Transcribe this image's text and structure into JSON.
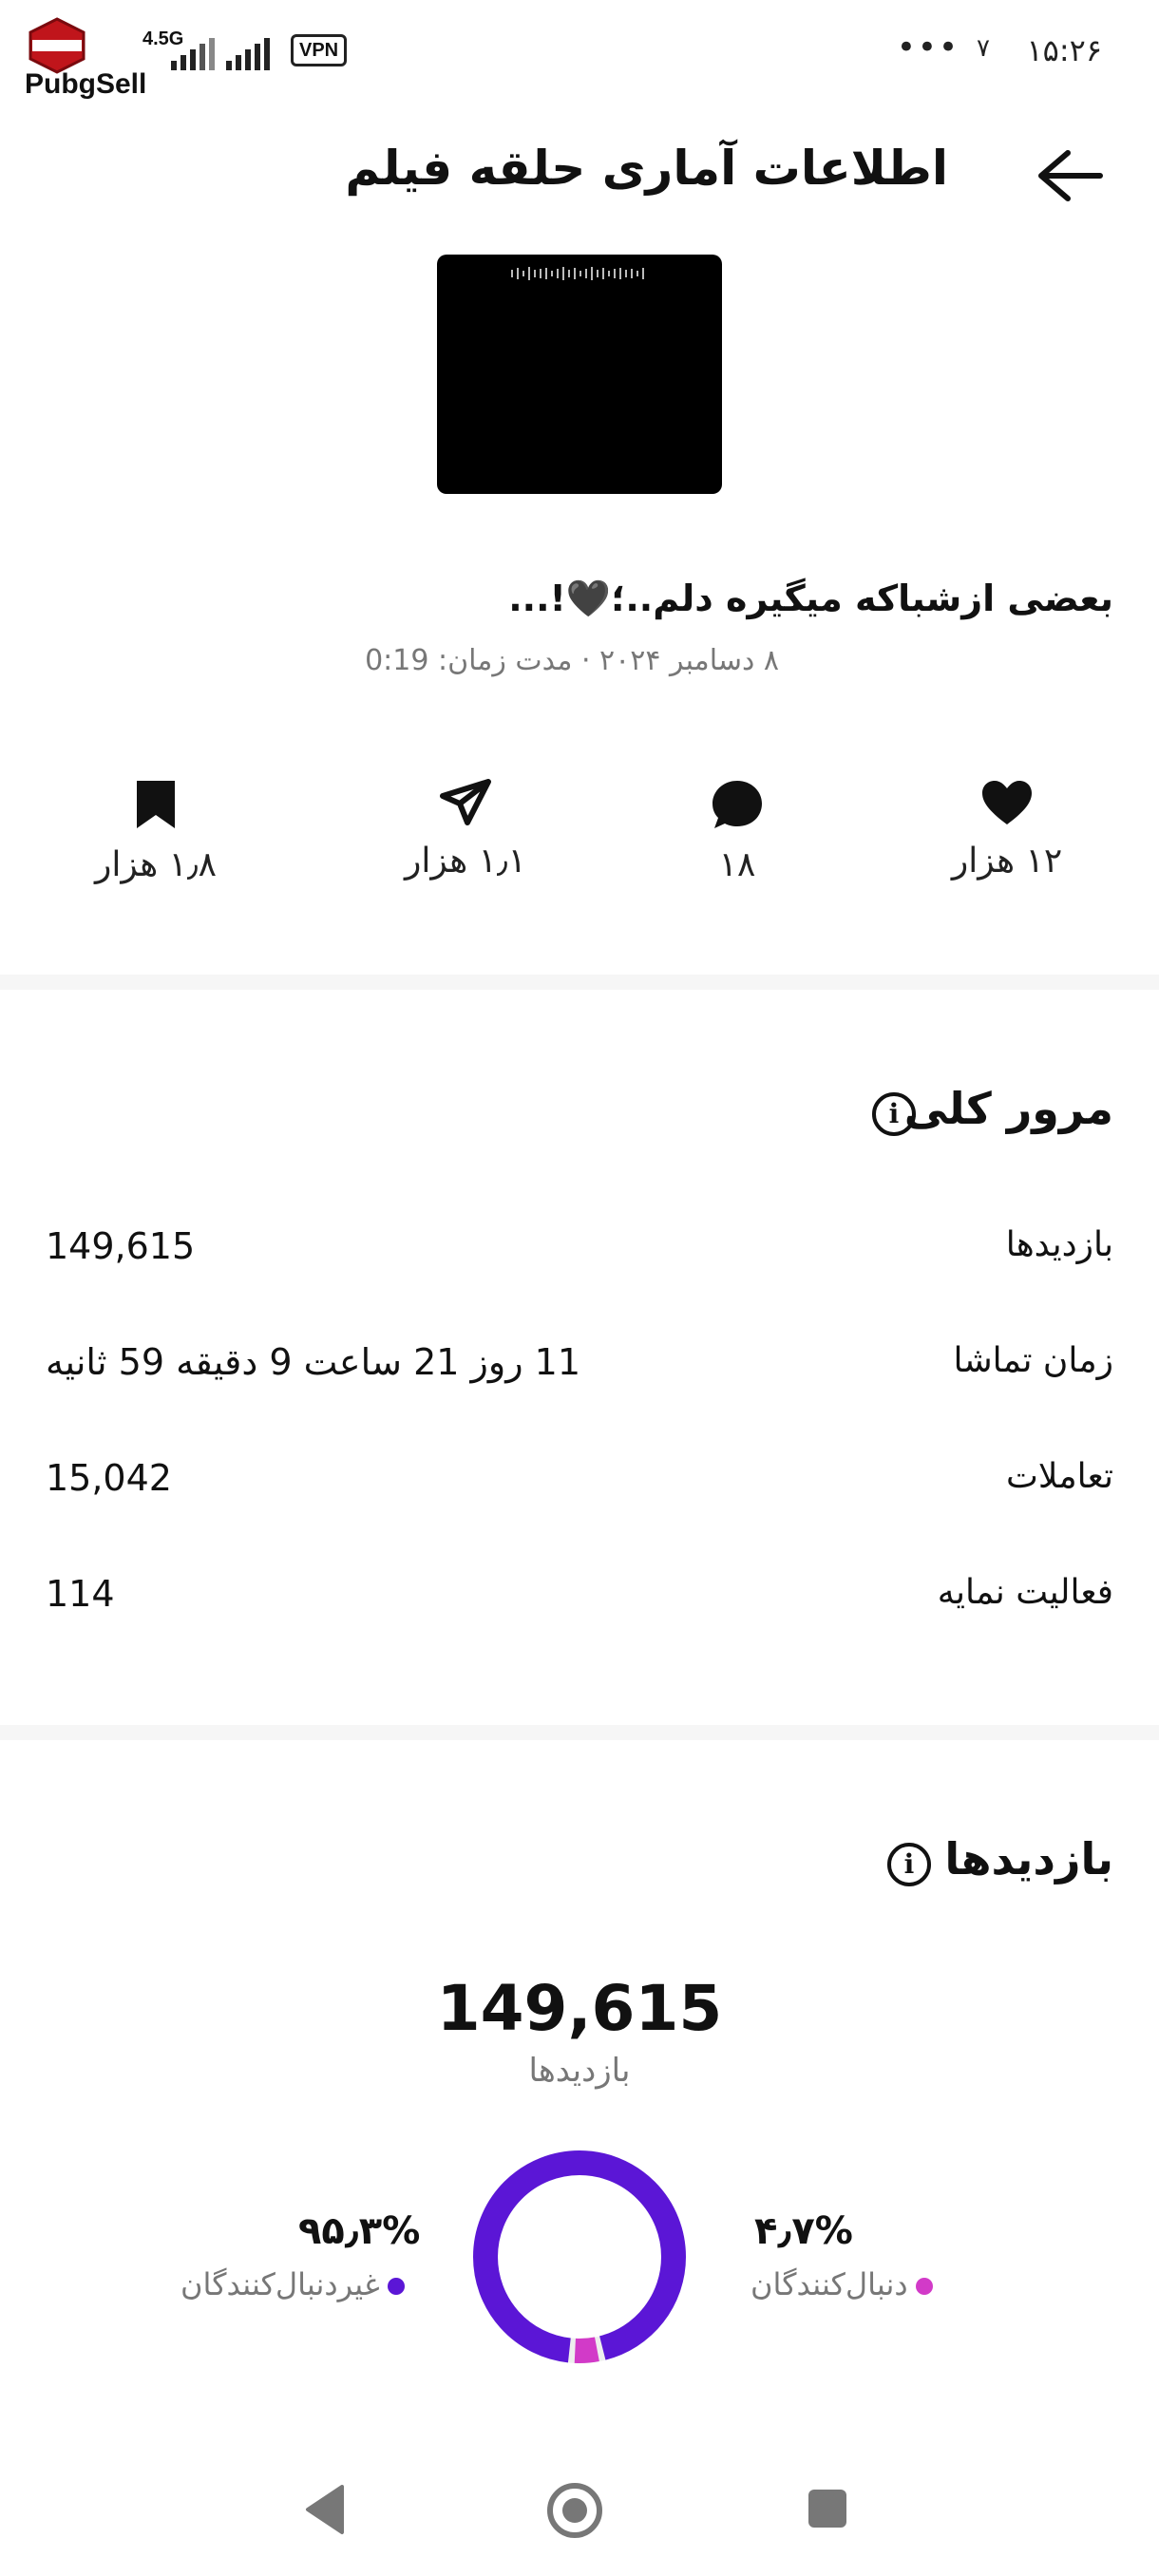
{
  "status_bar": {
    "brand": "PubgSell",
    "network_label": "4.5G",
    "vpn_label": "VPN",
    "dots": "•••",
    "indicator": "۷",
    "time": "۱۵:۲۶"
  },
  "header": {
    "title": "اطلاعات آماری حلقه فیلم"
  },
  "post": {
    "caption": "بعضی ازشباکه میگیره دلم..؛🖤!...",
    "meta": "۸ دسامبر ۲۰۲۴ · مدت زمان: 0:19"
  },
  "actions": {
    "likes": "۱۲ هزار",
    "comments": "۱۸",
    "shares": "۱٫۱ هزار",
    "saves": "۱٫۸ هزار"
  },
  "overview": {
    "title": "مرور کلی",
    "info_icon": "info-icon",
    "rows": [
      {
        "label": "بازدیدها",
        "value": "149,615"
      },
      {
        "label": "زمان تماشا",
        "value": "11 روز 21 ساعت 9 دقیقه 59 ثانیه"
      },
      {
        "label": "تعاملات",
        "value": "15,042"
      },
      {
        "label": "فعالیت نمایه",
        "value": "114"
      }
    ]
  },
  "views": {
    "title": "بازدیدها",
    "total": "149,615",
    "total_label": "بازدیدها",
    "followers_pct": "۴٫۷%",
    "followers_label": "دنبال‌کنندگان",
    "followers_fraction": 0.047,
    "nonfollowers_pct": "۹۵٫۳%",
    "nonfollowers_label": "غیردنبال‌کنندگان",
    "nonfollowers_fraction": 0.953,
    "colors": {
      "followers": "#d23ac8",
      "nonfollowers": "#5b16d6"
    }
  },
  "navbar": {
    "back": "back-triangle-icon",
    "home": "home-circle-icon",
    "recents": "recents-square-icon"
  }
}
